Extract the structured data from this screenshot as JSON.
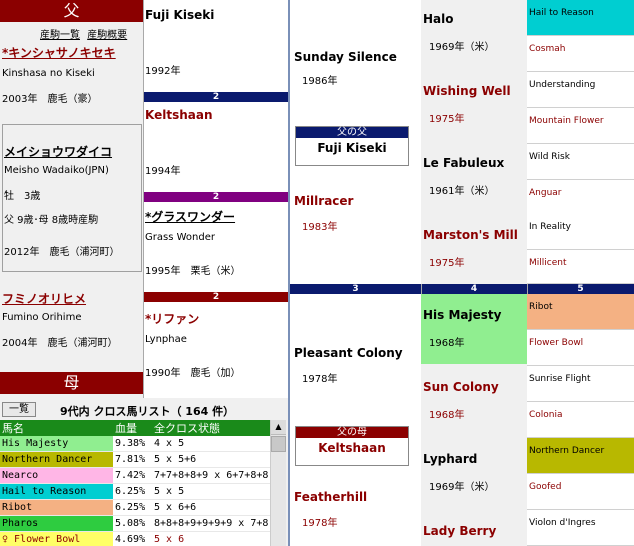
{
  "sire_header": "父",
  "dam_header": "母",
  "links": {
    "list": "産駒一覧",
    "summary": "産駒概要"
  },
  "sire": {
    "name_jp": "*キンシャサノキセキ",
    "name_en": "Kinshasa no Kiseki",
    "info": "2003年　鹿毛（豪）"
  },
  "horse": {
    "name_jp": "メイショウワダイコ",
    "name_en": "Meisho Wadaiko(JPN)",
    "sex_age": "牡　3歳",
    "age_note": "父 9歳･母 8歳時産駒",
    "info": "2012年　鹿毛（浦河町）"
  },
  "dam": {
    "name_jp": "フミノオリヒメ",
    "name_en": "Fumino Orihime",
    "info": "2004年　鹿毛（浦河町）"
  },
  "gen2": [
    {
      "name": "Fuji Kiseki",
      "year": "1992年"
    },
    {
      "name": "Keltshaan",
      "year": "1994年"
    },
    {
      "name_jp": "*グラスワンダー",
      "name_en": "Grass Wonder",
      "info": "1995年　栗毛（米）"
    },
    {
      "name_jp": "*リファン",
      "name_en": "Lynphae",
      "info": "1990年　鹿毛（加）"
    }
  ],
  "gen_labels": [
    "2",
    "2",
    "2",
    "3",
    "4",
    "5"
  ],
  "gen3": [
    {
      "name": "Sunday Silence",
      "year": "1986年"
    },
    {
      "name": "Millracer",
      "year": "1983年"
    },
    {
      "name": "Pleasant Colony",
      "year": "1978年"
    },
    {
      "name": "Featherhill",
      "year": "1978年"
    }
  ],
  "boxes": [
    {
      "label": "父の父",
      "name": "Fuji Kiseki"
    },
    {
      "label": "父の母",
      "name": "Keltshaan"
    }
  ],
  "gen4": [
    {
      "name": "Halo",
      "year": "1969年（米）"
    },
    {
      "name": "Wishing Well",
      "year": "1975年"
    },
    {
      "name": "Le Fabuleux",
      "year": "1961年（米）"
    },
    {
      "name": "Marston's Mill",
      "year": "1975年"
    },
    {
      "name": "His Majesty",
      "year": "1968年"
    },
    {
      "name": "Sun Colony",
      "year": "1968年"
    },
    {
      "name": "Lyphard",
      "year": "1969年（米）"
    },
    {
      "name": "Lady Berry",
      "year": ""
    }
  ],
  "gen5": [
    "Hail to Reason",
    "Cosmah",
    "Understanding",
    "Mountain Flower",
    "Wild Risk",
    "Anguar",
    "In Reality",
    "Millicent",
    "Ribot",
    "Flower Bowl",
    "Sunrise Flight",
    "Colonia",
    "Northern Dancer",
    "Goofed",
    "Violon d'Ingres"
  ],
  "cross": {
    "button": "一覧",
    "title": "9代内 クロス馬リスト（ 164 件）",
    "headers": [
      "馬名",
      "血量",
      "全クロス状態"
    ],
    "rows": [
      {
        "name": "His Majesty",
        "pct": "9.38%",
        "state": "4 x 5"
      },
      {
        "name": "Northern Dancer",
        "pct": "7.81%",
        "state": "5 x 5+6"
      },
      {
        "name": "Nearco",
        "pct": "7.42%",
        "state": "7+7+8+8+9 x 6+7+8+8"
      },
      {
        "name": "Hail to Reason",
        "pct": "6.25%",
        "state": "5 x 5"
      },
      {
        "name": "Ribot",
        "pct": "6.25%",
        "state": "5 x 6+6"
      },
      {
        "name": "Pharos",
        "pct": "5.08%",
        "state": "8+8+8+9+9+9+9 x 7+8"
      },
      {
        "name": "♀ Flower Bowl",
        "pct": "4.69%",
        "state": "5 x 6"
      }
    ]
  },
  "colors": {
    "sire_bar": "#0a1a6e",
    "dam_bar": "#8b0000",
    "purple_bar": "#800080",
    "green": "#1a8a1a"
  }
}
